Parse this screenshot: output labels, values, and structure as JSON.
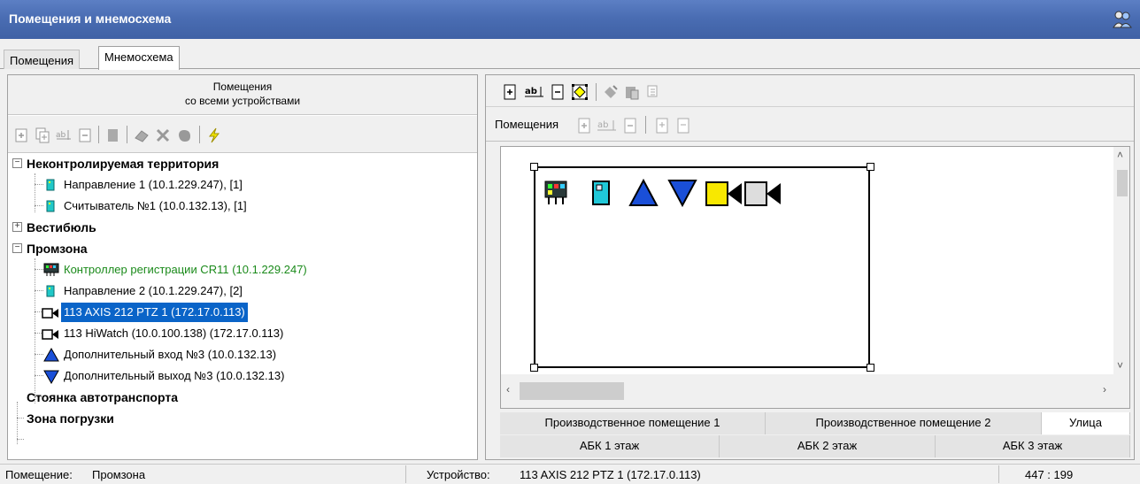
{
  "window": {
    "title": "Помещения и мнемосхема"
  },
  "tabs": [
    {
      "label": "Помещения",
      "active": false
    },
    {
      "label": "Мнемосхема",
      "active": true
    }
  ],
  "left_panel": {
    "header_line1": "Помещения",
    "header_line2": "со всеми устройствами",
    "toolbar_icons": [
      "add-room-icon",
      "add-copy-icon",
      "rename-icon",
      "delete-icon",
      "stop-icon",
      "eraser-icon",
      "cross-icon",
      "hand-icon",
      "lightning-icon"
    ],
    "tree": [
      {
        "label": "Неконтролируемая территория",
        "type": "group",
        "expanded": true
      },
      {
        "label": "Направление 1 (10.1.229.247), [1]",
        "type": "direction"
      },
      {
        "label": "Считыватель №1 (10.0.132.13), [1]",
        "type": "reader"
      },
      {
        "label": "Вестибюль",
        "type": "group",
        "expanded": false
      },
      {
        "label": "Промзона",
        "type": "group",
        "expanded": true
      },
      {
        "label": "Контроллер регистрации CR11 (10.1.229.247)",
        "type": "controller"
      },
      {
        "label": "Направление 2 (10.1.229.247), [2]",
        "type": "direction"
      },
      {
        "label": "113 AXIS 212 PTZ 1 (172.17.0.113)",
        "type": "camera",
        "selected": true
      },
      {
        "label": "113 HiWatch (10.0.100.138) (172.17.0.113)",
        "type": "camera"
      },
      {
        "label": "Дополнительный вход №3 (10.0.132.13)",
        "type": "entry"
      },
      {
        "label": "Дополнительный выход №3 (10.0.132.13)",
        "type": "exit"
      },
      {
        "label": "Стоянка автотранспорта",
        "type": "group"
      },
      {
        "label": "Зона погрузки",
        "type": "group"
      }
    ]
  },
  "right_panel": {
    "toolbar1_icons": [
      "add-icon",
      "text-icon",
      "minus-icon",
      "select-icon",
      "paint-icon",
      "paste-icon",
      "copy-format-icon"
    ],
    "toolbar2_label": "Помещения",
    "toolbar2_icons": [
      "add-room-icon",
      "rename-room-icon",
      "delete-room-icon",
      "import-icon",
      "export-icon"
    ],
    "plan_tabs_row1": [
      {
        "label": "Производственное помещение 1",
        "active": false
      },
      {
        "label": "Производственное помещение 2",
        "active": false
      },
      {
        "label": "Улица",
        "active": true
      }
    ],
    "plan_tabs_row2": [
      {
        "label": "АБК 1 этаж"
      },
      {
        "label": "АБК 2 этаж"
      },
      {
        "label": "АБК 3 этаж"
      }
    ]
  },
  "status": {
    "room_label": "Помещение:",
    "room_value": "Промзона",
    "device_label": "Устройство:",
    "device_value": "113 AXIS 212 PTZ 1 (172.17.0.113)",
    "coords": "447 : 199"
  },
  "colors": {
    "titlebar": "#4a6db3",
    "selection": "#0a64c8",
    "controller_text": "#1a8a1a"
  }
}
